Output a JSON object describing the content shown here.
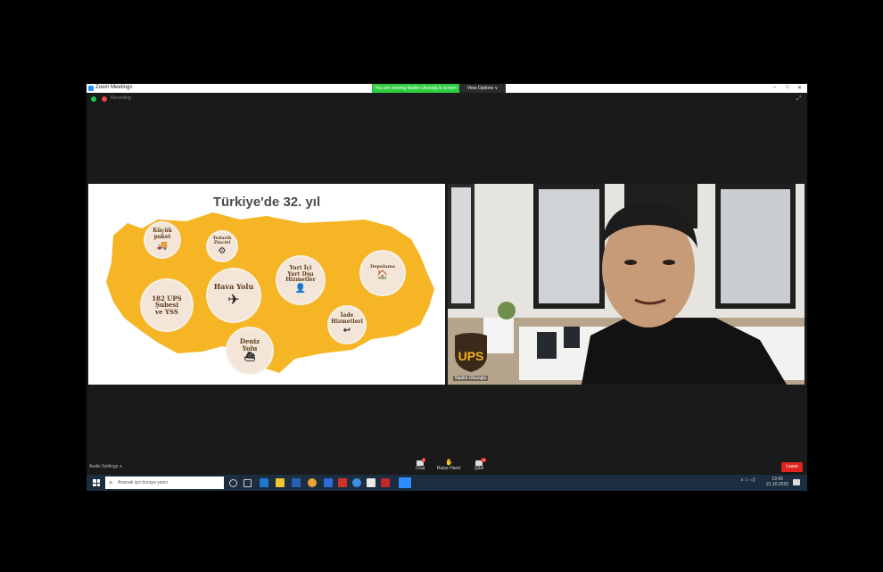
{
  "window": {
    "title": "Zoom Meetings"
  },
  "banner": {
    "share_text": "You are viewing Nadim Ulusoglu's screen",
    "view_options": "View Options ∨"
  },
  "window_controls": {
    "minimize": "–",
    "maximize": "□",
    "close": "✕"
  },
  "topbar": {
    "rec_label": "Recording"
  },
  "slide": {
    "title": "Türkiye'de 32. yıl",
    "map_color": "#f5b524",
    "items": [
      {
        "label": "Küçük\npaket",
        "icon": "🚚"
      },
      {
        "label": "Tedarik\nZinciri",
        "icon": "⚙"
      },
      {
        "label": "Yurt İçi\nYurt Dışı\nHizmetler",
        "icon": "👤"
      },
      {
        "label": "Depolama",
        "icon": "🏠"
      },
      {
        "label": "182 UPS\nŞubesi\nve YSS",
        "icon": ""
      },
      {
        "label": "Hava Yolu",
        "icon": "✈"
      },
      {
        "label": "İade\nHizmetleri",
        "icon": "↩"
      },
      {
        "label": "Deniz\nYolu",
        "icon": "⛴"
      }
    ]
  },
  "camera": {
    "name_tag": "Nadim Ulusoglu",
    "logo_text": "UPS"
  },
  "bottombar": {
    "audio": "Audio Settings ∧",
    "chat": "Chat",
    "chat_badge": "5",
    "raise_hand": "Raise Hand",
    "qa": "Q&A",
    "qa_badge": "10",
    "leave": "Leave"
  },
  "taskbar": {
    "search_placeholder": "Aramak için buraya yazın",
    "time": "13:43",
    "date": "21.10.2020",
    "tray": "∧ ▭ ◁)"
  }
}
